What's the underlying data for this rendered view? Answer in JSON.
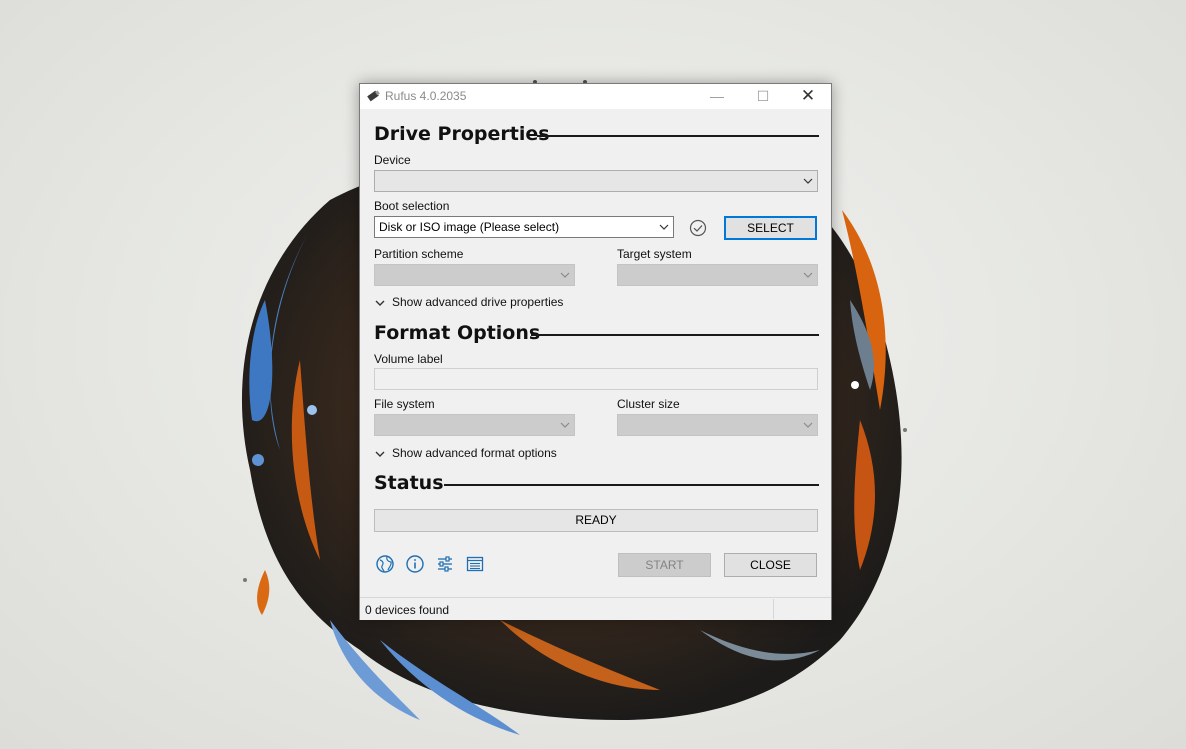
{
  "window": {
    "title": "Rufus 4.0.2035",
    "minimize_glyph": "—",
    "maximize_glyph": "☐",
    "close_glyph": "✕"
  },
  "drive_properties": {
    "heading": "Drive Properties",
    "device_label": "Device",
    "device_value": "",
    "boot_selection_label": "Boot selection",
    "boot_selection_value": "Disk or ISO image (Please select)",
    "select_button": "SELECT",
    "partition_scheme_label": "Partition scheme",
    "partition_scheme_value": "",
    "target_system_label": "Target system",
    "target_system_value": "",
    "advanced_toggle": "Show advanced drive properties"
  },
  "format_options": {
    "heading": "Format Options",
    "volume_label_label": "Volume label",
    "volume_label_value": "",
    "file_system_label": "File system",
    "file_system_value": "",
    "cluster_size_label": "Cluster size",
    "cluster_size_value": "",
    "advanced_toggle": "Show advanced format options"
  },
  "status": {
    "heading": "Status",
    "progress_text": "READY",
    "progress_fraction": 0
  },
  "toolbar": {
    "icons": [
      "globe-icon",
      "info-icon",
      "settings-sliders-icon",
      "log-icon"
    ],
    "start_button": "START",
    "close_button": "CLOSE"
  },
  "statusbar": {
    "text": "0 devices found"
  },
  "colors": {
    "accent": "#0078d7",
    "icon_blue": "#1e6fb3",
    "window_bg": "#f0f0f0"
  }
}
